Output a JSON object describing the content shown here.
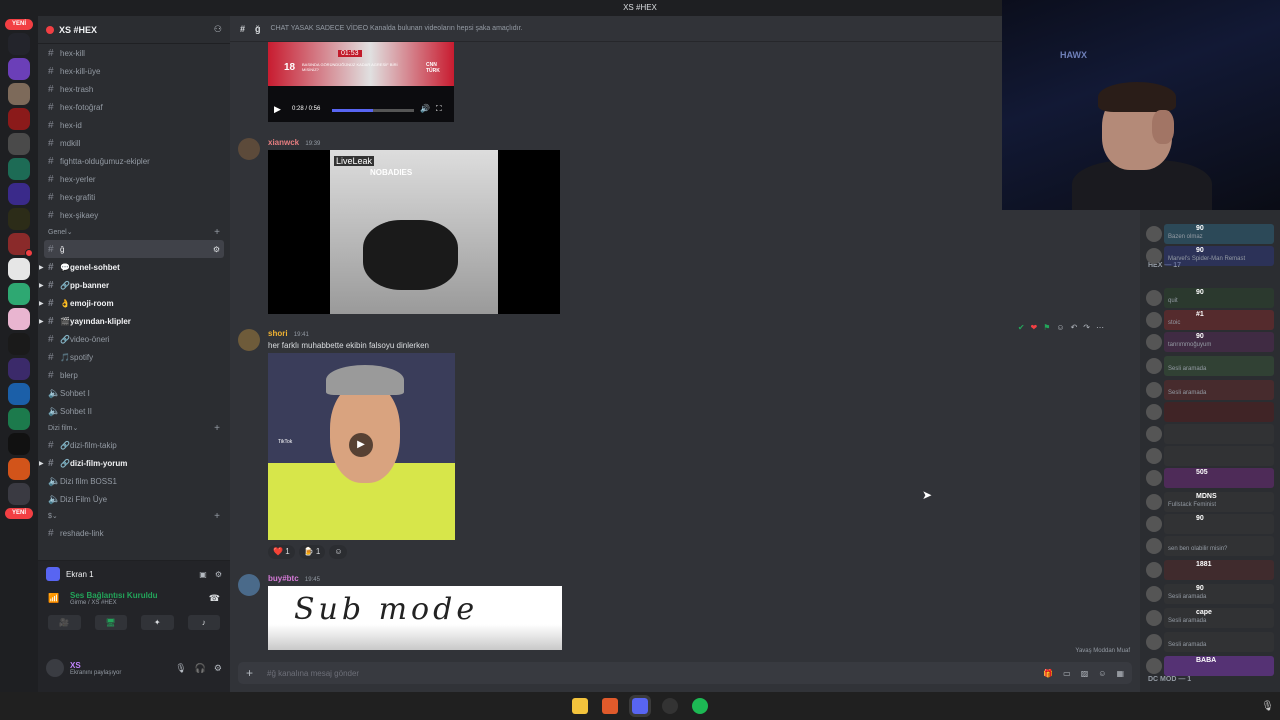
{
  "window_title": "XS #HEX",
  "badges": {
    "new": "YENİ"
  },
  "guild": {
    "name": "XS #HEX"
  },
  "channels": [
    {
      "name": "hex-kill",
      "type": "text"
    },
    {
      "name": "hex-kill-üye",
      "type": "text"
    },
    {
      "name": "hex-trash",
      "type": "text"
    },
    {
      "name": "hex-fotoğraf",
      "type": "text"
    },
    {
      "name": "hex-id",
      "type": "text"
    },
    {
      "name": "mdkill",
      "type": "text"
    },
    {
      "name": "fightta-olduğumuz-ekipler",
      "type": "text"
    },
    {
      "name": "hex-yerler",
      "type": "text"
    },
    {
      "name": "hex-grafiti",
      "type": "text"
    },
    {
      "name": "hex-şikaey",
      "type": "text"
    }
  ],
  "category_genel": "Genel",
  "genel_channels": [
    {
      "name": "ğ",
      "prefix": "",
      "active": true
    },
    {
      "name": "genel-sohbet",
      "prefix": "💬",
      "bold": true
    },
    {
      "name": "pp-banner",
      "prefix": "🔗",
      "bold": true
    },
    {
      "name": "emoji-room",
      "prefix": "👌",
      "bold": true
    },
    {
      "name": "yayından-klipler",
      "prefix": "🎬",
      "bold": true
    },
    {
      "name": "video-öneri",
      "prefix": "🔗"
    },
    {
      "name": "spotify",
      "prefix": "🎵"
    },
    {
      "name": "blerp",
      "prefix": ""
    },
    {
      "name": "Sohbet I",
      "prefix": "🔊"
    },
    {
      "name": "Sohbet II",
      "prefix": "🔊"
    }
  ],
  "category_dizi": "Dizi film",
  "dizi_channels": [
    {
      "name": "dizi-film-takip",
      "prefix": "🔗"
    },
    {
      "name": "dizi-film-yorum",
      "prefix": "🔗",
      "bold": true
    },
    {
      "name": "Dizi film BOSS1",
      "prefix": "🔊"
    },
    {
      "name": "Dizi Film Üye",
      "prefix": "🔊"
    }
  ],
  "category_dollar": "$",
  "reshade": "reshade-link",
  "stream": {
    "label": "Ekran 1"
  },
  "voice": {
    "status": "Ses Bağlantısı Kuruldu",
    "location": "Girme / XS #HEX"
  },
  "user": {
    "name": "XS",
    "status": "Ekranını paylaşıyor"
  },
  "chat": {
    "channel": "ğ",
    "topic": "CHAT YASAK SADECE VİDEO Kanalda bulunan videoların hepsi şaka amaçlıdır.",
    "video1": {
      "time": "0:28 / 0:56",
      "headline": "BASINDA GÖRÜNDÜĞÜNÜZ KADAR AGRESİF BİRİ MİSİNİZ?",
      "age": "18",
      "clock": "01:53",
      "network": "CNN TÜRK"
    },
    "messages": [
      {
        "author": "xianwck",
        "time": "19:39",
        "media_text": "NOBADIES",
        "media_logo": "LiveLeak"
      },
      {
        "author": "shori",
        "time": "19:41",
        "text": "her farklı muhabbette ekibin falsoyu dinlerken",
        "reactions": [
          {
            "emoji": "❤️",
            "count": "1"
          },
          {
            "emoji": "🍺",
            "count": "1"
          }
        ],
        "media_tag": "TikTok"
      },
      {
        "author": "buy#btc",
        "time": "19:45",
        "media_text": "Sub mode"
      }
    ],
    "composer_placeholder": "#ğ kanalına mesaj gönder",
    "slowmode": "Yavaş Moddan Muaf"
  },
  "members_sections": {
    "hex": "HEX — 17",
    "dcmod": "DC MOD — 1"
  },
  "members": [
    {
      "status": "Bazen olmaz",
      "badge": "90"
    },
    {
      "status": "Marvel's Spider-Man Remast",
      "badge": "90"
    },
    {
      "status": "quit",
      "badge": "90"
    },
    {
      "status": "stoic",
      "badge": "#1"
    },
    {
      "status": "tanrımmoğuyum",
      "badge": "90"
    },
    {
      "status": "Sesli aramada",
      "badge": ""
    },
    {
      "status": "Sesli aramada",
      "badge": ""
    },
    {
      "status": "",
      "badge": ""
    },
    {
      "status": "",
      "badge": ""
    },
    {
      "status": "",
      "badge": ""
    },
    {
      "status": "",
      "badge": "505"
    },
    {
      "status": "Fullstack Feminist",
      "badge": "MDNS"
    },
    {
      "status": "",
      "badge": "90"
    },
    {
      "status": "sen ben olabilir misin?",
      "badge": ""
    },
    {
      "status": "",
      "badge": "1881"
    },
    {
      "status": "Sesli aramada",
      "badge": "90"
    },
    {
      "status": "Sesli aramada",
      "badge": "cape"
    },
    {
      "status": "Sesli aramada",
      "badge": ""
    },
    {
      "status": "",
      "badge": "BABA"
    }
  ],
  "webcam_logo": "HAWX"
}
